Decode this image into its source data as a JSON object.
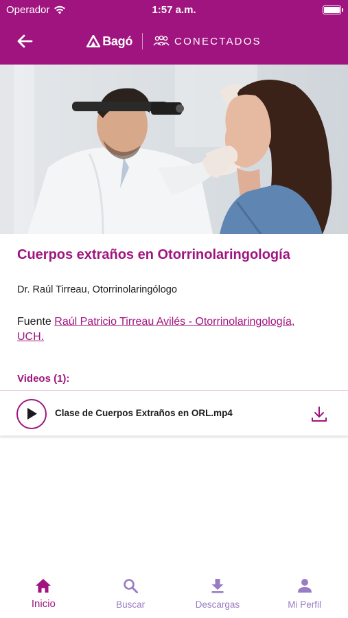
{
  "status_bar": {
    "carrier": "Operador",
    "time": "1:57 a.m."
  },
  "nav": {
    "back_icon": "arrow-left-icon",
    "brand_name": "Bagó",
    "app_name": "CONECTADOS"
  },
  "content": {
    "title": "Cuerpos extraños en Otorrinolaringología",
    "author": "Dr. Raúl Tirreau, Otorrinolaringólogo",
    "source_label": "Fuente",
    "source_link": "Raúl Patricio Tirreau Avilés - Otorrinolaringología, UCH.",
    "videos_header": "Videos (1):",
    "videos": [
      {
        "name": "Clase de Cuerpos Extraños en ORL.mp4"
      }
    ]
  },
  "tabs": [
    {
      "label": "Inicio",
      "icon": "home-icon",
      "active": true
    },
    {
      "label": "Buscar",
      "icon": "search-icon",
      "active": false
    },
    {
      "label": "Descargas",
      "icon": "download-icon",
      "active": false
    },
    {
      "label": "Mi Perfil",
      "icon": "person-icon",
      "active": false
    }
  ],
  "colors": {
    "brand": "#a0147f",
    "tab_inactive": "#9a7cc2"
  }
}
